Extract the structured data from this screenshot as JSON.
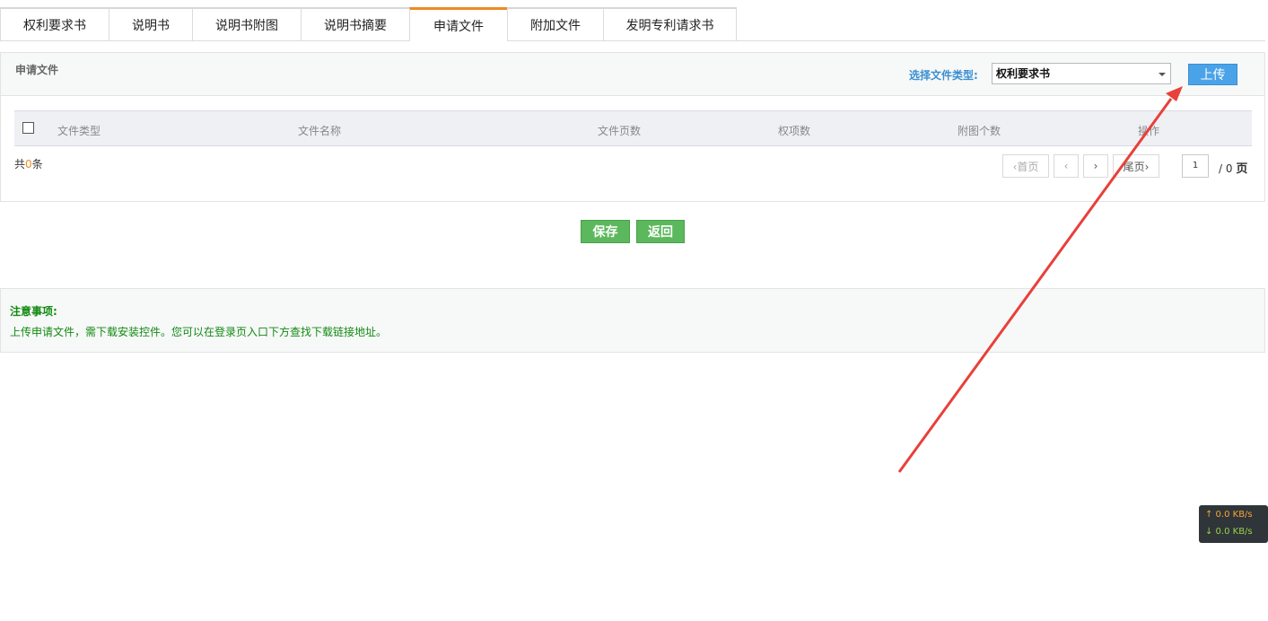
{
  "tabs": [
    {
      "label": "权利要求书",
      "active": false
    },
    {
      "label": "说明书",
      "active": false
    },
    {
      "label": "说明书附图",
      "active": false
    },
    {
      "label": "说明书摘要",
      "active": false
    },
    {
      "label": "申请文件",
      "active": true
    },
    {
      "label": "附加文件",
      "active": false
    },
    {
      "label": "发明专利请求书",
      "active": false
    }
  ],
  "panel": {
    "title": "申请文件",
    "file_type_label": "选择文件类型:",
    "file_type_value": "权利要求书",
    "upload_label": "上传"
  },
  "grid": {
    "columns": [
      "文件类型",
      "文件名称",
      "文件页数",
      "权项数",
      "附图个数",
      "操作"
    ],
    "rows": []
  },
  "summary": {
    "prefix": "共",
    "count": "0",
    "suffix": "条"
  },
  "pager": {
    "first": "‹首页",
    "prev": "‹",
    "next": "›",
    "last": "尾页›",
    "current_page": "1",
    "total_text": "/ 0",
    "page_unit": "页"
  },
  "actions": {
    "save_label": "保存",
    "back_label": "返回"
  },
  "notice": {
    "title": "注意事项:",
    "text": "上传申请文件，需下载安装控件。您可以在登录页入口下方查找下载链接地址。"
  },
  "network": {
    "up": "↑ 0.0 KB/s",
    "down": "↓ 0.0 KB/s"
  },
  "colors": {
    "tab_active": "#f08a24",
    "upload": "#4aa3e8",
    "save": "#5cb85c",
    "notice_text": "#128a12",
    "annotation_arrow": "#e8403a"
  }
}
